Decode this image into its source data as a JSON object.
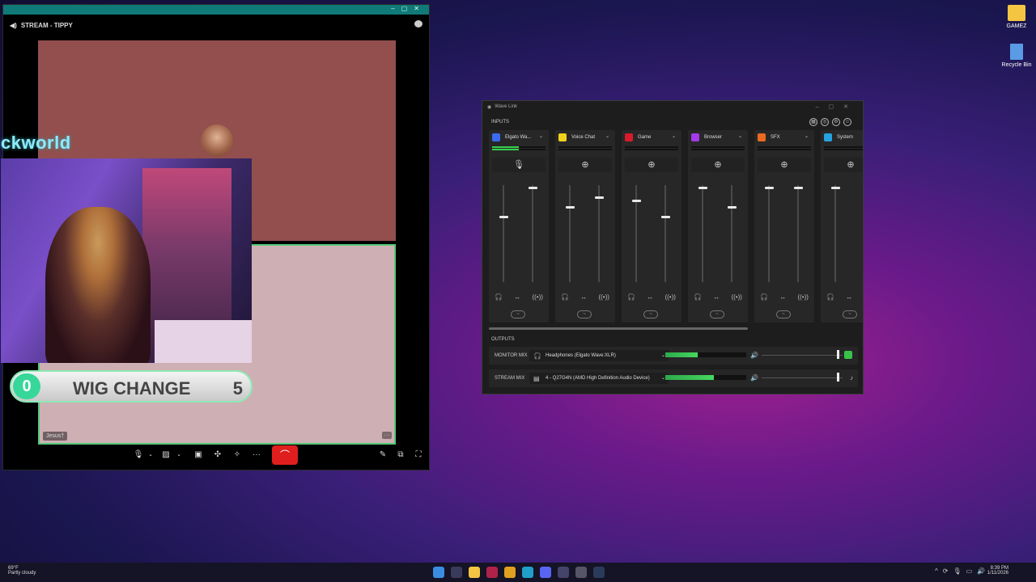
{
  "desktop": {
    "icons": [
      {
        "label": "GAMEZ",
        "icon": "folder-icon",
        "color": "#f4c542"
      },
      {
        "label": "Recycle Bin",
        "icon": "recycle-bin-icon",
        "color": "#5a9be6"
      }
    ]
  },
  "discord": {
    "channel_title": "STREAM - TIPPY",
    "overlay_text": "ckworld",
    "counter": {
      "left": "0",
      "label": "WIG CHANGE",
      "right": "5"
    },
    "participant_name": "Jesus†",
    "controls": {
      "mic_icon": "microphone-icon",
      "camera_icon": "camera-off-icon",
      "share_icon": "screen-share-icon",
      "activities_icon": "activities-icon",
      "soundboard_icon": "soundboard-icon",
      "more_label": "···",
      "end_icon": "hang-up-icon"
    },
    "colors": {
      "titlebar": "#0f7a78",
      "end_call": "#e01e1e",
      "speaking_border": "#56c978"
    }
  },
  "wave_link": {
    "title": "Wave Link",
    "inputs_label": "INPUTS",
    "outputs_label": "OUTPUTS",
    "channels": [
      {
        "name": "Elgato Wa...",
        "color": "#3b6cf0",
        "left_fader_pct": 0.68,
        "right_fader_pct": 0.98
      },
      {
        "name": "Voice Chat",
        "color": "#f2d21b",
        "left_fader_pct": 0.78,
        "right_fader_pct": 0.88
      },
      {
        "name": "Game",
        "color": "#d81b2a",
        "left_fader_pct": 0.85,
        "right_fader_pct": 0.68
      },
      {
        "name": "Browser",
        "color": "#a33be8",
        "left_fader_pct": 0.98,
        "right_fader_pct": 0.78
      },
      {
        "name": "SFX",
        "color": "#ea6a1f",
        "left_fader_pct": 0.98,
        "right_fader_pct": 0.98
      },
      {
        "name": "System",
        "color": "#25a3e0",
        "left_fader_pct": 0.98,
        "right_fader_pct": null
      }
    ],
    "outputs": [
      {
        "label": "MONITOR MIX",
        "device": "Headphones (Elgato Wave:XLR)",
        "level": 0.4
      },
      {
        "label": "STREAM MIX",
        "device": "4 - Q27G4N (AMD High Definition Audio Device)",
        "level": 0.6
      }
    ]
  },
  "taskbar": {
    "weather_temp": "69°F",
    "weather_desc": "Partly cloudy",
    "time": "8:39 PM",
    "date": "1/11/2026"
  }
}
